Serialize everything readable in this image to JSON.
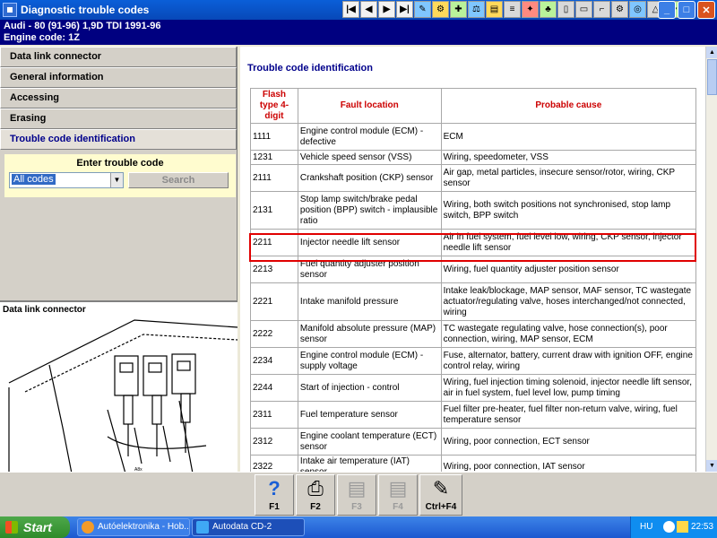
{
  "window": {
    "title": "Diagnostic trouble codes"
  },
  "vehicle": {
    "model": "Audi - 80 (91-96) 1,9D TDI 1991-96",
    "engine": "Engine code: 1Z"
  },
  "sidebar": {
    "items": [
      {
        "label": "Data link connector"
      },
      {
        "label": "General information"
      },
      {
        "label": "Accessing"
      },
      {
        "label": "Erasing"
      },
      {
        "label": "Trouble code identification",
        "active": true
      }
    ]
  },
  "entry": {
    "title": "Enter trouble code",
    "select_value": "All codes",
    "search_label": "Search"
  },
  "connector": {
    "label": "Data link connector"
  },
  "main": {
    "section_title": "Trouble code identification",
    "table": {
      "headers": [
        "Flash type 4-digit",
        "Fault location",
        "Probable cause"
      ],
      "rows": [
        [
          "1111",
          "Engine control module (ECM) - defective",
          "ECM"
        ],
        [
          "1231",
          "Vehicle speed sensor (VSS)",
          "Wiring, speedometer, VSS"
        ],
        [
          "2111",
          "Crankshaft position (CKP) sensor",
          "Air gap, metal particles, insecure sensor/rotor, wiring, CKP sensor"
        ],
        [
          "2131",
          "Stop lamp switch/brake pedal position (BPP) switch - implausible ratio",
          "Wiring, both switch positions not synchronised, stop lamp switch, BPP switch"
        ],
        [
          "2211",
          "Injector needle lift sensor",
          "Air in fuel system, fuel level low, wiring, CKP sensor, injector needle lift sensor"
        ],
        [
          "2213",
          "Fuel quantity adjuster position sensor",
          "Wiring, fuel quantity adjuster position sensor"
        ],
        [
          "2221",
          "Intake manifold pressure",
          "Intake leak/blockage, MAP sensor, MAF sensor, TC wastegate actuator/regulating valve, hoses interchanged/not connected, wiring"
        ],
        [
          "2222",
          "Manifold absolute pressure (MAP) sensor",
          "TC wastegate regulating valve, hose connection(s), poor connection, wiring, MAP sensor, ECM"
        ],
        [
          "2234",
          "Engine control module (ECM) - supply voltage",
          "Fuse, alternator, battery, current draw with ignition OFF, engine control relay, wiring"
        ],
        [
          "2244",
          "Start of injection - control",
          "Wiring, fuel injection timing solenoid, injector needle lift sensor, air in fuel system, fuel level low, pump timing"
        ],
        [
          "2311",
          "Fuel temperature sensor",
          "Fuel filter pre-heater, fuel filter non-return valve, wiring, fuel temperature sensor"
        ],
        [
          "2312",
          "Engine coolant temperature (ECT) sensor",
          "Wiring, poor connection, ECT sensor"
        ],
        [
          "2322",
          "Intake air temperature (IAT) sensor",
          "Wiring, poor connection, IAT sensor"
        ]
      ]
    }
  },
  "fkeys": [
    {
      "label": "F1",
      "icon": "help-question-icon",
      "enabled": true
    },
    {
      "label": "F2",
      "icon": "printer-icon",
      "enabled": true
    },
    {
      "label": "F3",
      "icon": "document-icon",
      "enabled": false
    },
    {
      "label": "F4",
      "icon": "document-icon",
      "enabled": false
    },
    {
      "label": "Ctrl+F4",
      "icon": "notes-icon",
      "enabled": true
    }
  ],
  "taskbar": {
    "start_label": "Start",
    "tasks": [
      {
        "label": "Autóelektronika - Hob..."
      },
      {
        "label": "Autodata CD-2"
      }
    ],
    "language": "HU",
    "clock": "22:53"
  }
}
